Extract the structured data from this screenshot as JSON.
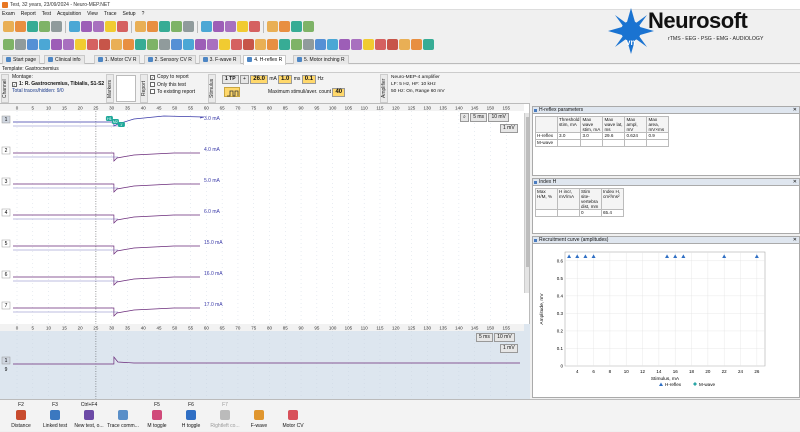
{
  "window": {
    "title": "Test, 32 years, 23/09/2024 - Neuro-MEP.NET"
  },
  "menu": [
    "Exam",
    "Report",
    "Test",
    "Acquisition",
    "View",
    "Trace",
    "Setup",
    "?"
  ],
  "logo": {
    "brand": "Neurosoft",
    "suffix": "vn",
    "tagline": "rTMS - EEG - PSG - EMG - AUDIOLOGY"
  },
  "tabs": [
    "Start page",
    "Clinical info",
    "1. Motor CV R",
    "2. Sensory CV R",
    "3. F-wave R",
    "4. H-reflex R",
    "5. Motor inching R"
  ],
  "active_tab": 5,
  "template": "Template: Gastrocnemius",
  "channel_label": "Channel",
  "montage": {
    "label": "Montage:",
    "item": "1: R. Gastrocnemius, Tibialis, S1-S2",
    "traces": "Total traces/hidden: 9/0"
  },
  "report_opts": {
    "label": "Report",
    "copy": "Copy to report",
    "only": "Only this test",
    "existing": "To existing report"
  },
  "stim": {
    "label": "Stimulus",
    "mode": "1 TP",
    "intensity": "26.0",
    "unit_ma": "mA",
    "duration": "1.0",
    "unit_ms": "ms",
    "freq": "0.1",
    "unit_hz": "Hz",
    "max_label": "Maximum stimuli/aver. count",
    "max_count": "40"
  },
  "amp": {
    "label": "Amplifier",
    "name": "Neuro-MEP-4 amplifier",
    "lf": "LF: 5 Hz, HF: 10 kHz",
    "notch": "50 Hz: On, Range 60 mV"
  },
  "ticks": [
    "0",
    "5",
    "10",
    "15",
    "20",
    "25",
    "30",
    "35",
    "40",
    "45",
    "50",
    "55",
    "60",
    "65",
    "70",
    "75",
    "80",
    "85",
    "90",
    "95",
    "100",
    "105",
    "110",
    "115",
    "120",
    "125",
    "130",
    "135",
    "140",
    "145",
    "150",
    "155"
  ],
  "ticks2": [
    "0",
    "5",
    "10",
    "15",
    "20",
    "25",
    "30",
    "35",
    "40",
    "45",
    "50",
    "55",
    "60",
    "65",
    "70",
    "75",
    "80",
    "85",
    "90",
    "95",
    "100",
    "105",
    "110",
    "115",
    "120",
    "125",
    "130",
    "135",
    "140",
    "145",
    "150",
    "155"
  ],
  "sweep": {
    "time": "5 ms",
    "gain": "10 mV",
    "gain2": "1 mV"
  },
  "sweep2": {
    "time": "5 ms",
    "gain": "10 mV",
    "gain2": "1 mV"
  },
  "traces": [
    {
      "n": "1",
      "ma": "3.0 mA"
    },
    {
      "n": "2",
      "ma": "4.0 mA"
    },
    {
      "n": "3",
      "ma": "5.0 mA"
    },
    {
      "n": "4",
      "ma": "6.0 mA"
    },
    {
      "n": "5",
      "ma": "15.0 mA"
    },
    {
      "n": "6",
      "ma": "16.0 mA"
    },
    {
      "n": "7",
      "ma": "17.0 mA"
    }
  ],
  "markers": [
    "H1",
    "M2",
    "1'"
  ],
  "bottom_trace": {
    "n": "1",
    "sub": "9"
  },
  "hreflex": {
    "title": "H-reflex parameters",
    "headers": [
      "",
      "Threshold stim, mA",
      "Max wave stim, mA",
      "Max wave lat, ms",
      "Max ampl, mV",
      "Max area, mV×ms"
    ],
    "rows": [
      [
        "H-reflex",
        "3.0",
        "3.0",
        "29.6",
        "0.624",
        "0.9"
      ],
      [
        "M-wave",
        "",
        "",
        "",
        "",
        ""
      ]
    ]
  },
  "indexh": {
    "title": "Index H",
    "headers": [
      "Max H/M, %",
      "H incr, mV/mA",
      "Stim site-vertebra dist, mm",
      "Index H, cm²/ms²"
    ],
    "rows": [
      [
        "",
        "",
        "0",
        "65.4"
      ]
    ]
  },
  "recruit": {
    "title": "Recruitment curve (amplitudes)"
  },
  "chart_data": {
    "type": "scatter",
    "title": "Recruitment curve (amplitudes)",
    "xlabel": "Stimulus, mA",
    "ylabel": "Amplitude, mV",
    "xticks": [
      4,
      6,
      8,
      10,
      12,
      14,
      16,
      18,
      20,
      22,
      24,
      26
    ],
    "yticks": [
      0,
      0.1,
      0.2,
      0.3,
      0.4,
      0.5,
      0.6
    ],
    "xlim": [
      2.5,
      27
    ],
    "ylim": [
      0,
      0.65
    ],
    "series": [
      {
        "name": "H-reflex",
        "color": "#2f6fc4",
        "x": [
          3,
          4,
          5,
          6,
          15,
          16,
          17,
          22,
          26
        ],
        "y": [
          0.624,
          0.624,
          0.624,
          0.624,
          0.624,
          0.624,
          0.624,
          0.624,
          0.624
        ]
      },
      {
        "name": "M-wave",
        "color": "#2aa6a6",
        "x": [],
        "y": []
      }
    ]
  },
  "fkeys": [
    {
      "k": "F2",
      "l": "Distance",
      "c": "#c84b2e"
    },
    {
      "k": "F3",
      "l": "Linked test",
      "c": "#3b78c0"
    },
    {
      "k": "Ctrl+F4",
      "l": "New test, o...",
      "c": "#6c4aa6"
    },
    {
      "k": "",
      "l": "Trace comm...",
      "c": "#5a8fc8"
    },
    {
      "k": "F5",
      "l": "M toggle",
      "c": "#d04a7a"
    },
    {
      "k": "F6",
      "l": "H toggle",
      "c": "#2f6fc4"
    },
    {
      "k": "F7",
      "l": "Rightleft co...",
      "c": "#bbbbbb",
      "dis": true
    },
    {
      "k": "",
      "l": "F-wave",
      "c": "#e0962e"
    },
    {
      "k": "",
      "l": "Motor CV",
      "c": "#d8505a"
    }
  ]
}
